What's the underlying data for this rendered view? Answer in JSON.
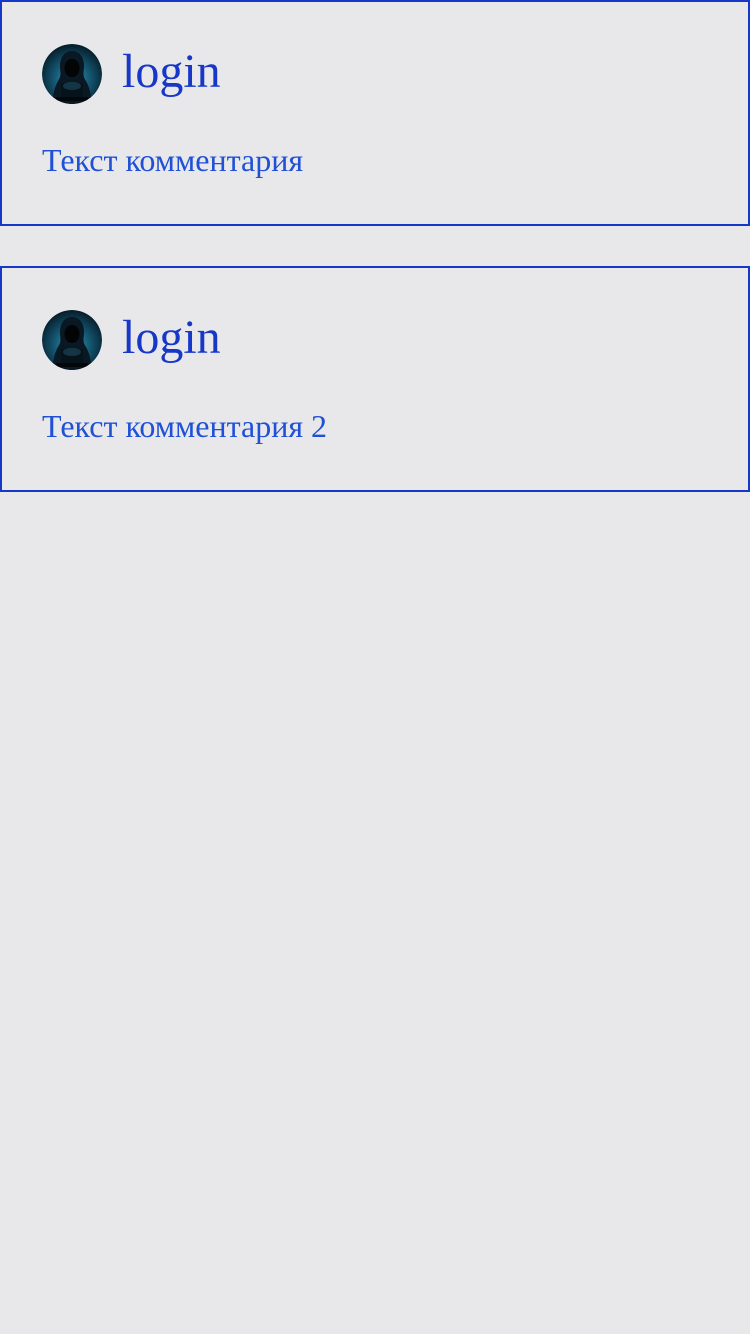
{
  "comments": [
    {
      "author": "login",
      "avatar_icon": "hooded-hacker-avatar",
      "text": "Текст комментария"
    },
    {
      "author": "login",
      "avatar_icon": "hooded-hacker-avatar",
      "text": "Текст комментария 2"
    }
  ],
  "colors": {
    "background": "#e8e8ea",
    "card_border": "#1637c8",
    "author_text": "#1637c8",
    "comment_text": "#1f50d6"
  }
}
